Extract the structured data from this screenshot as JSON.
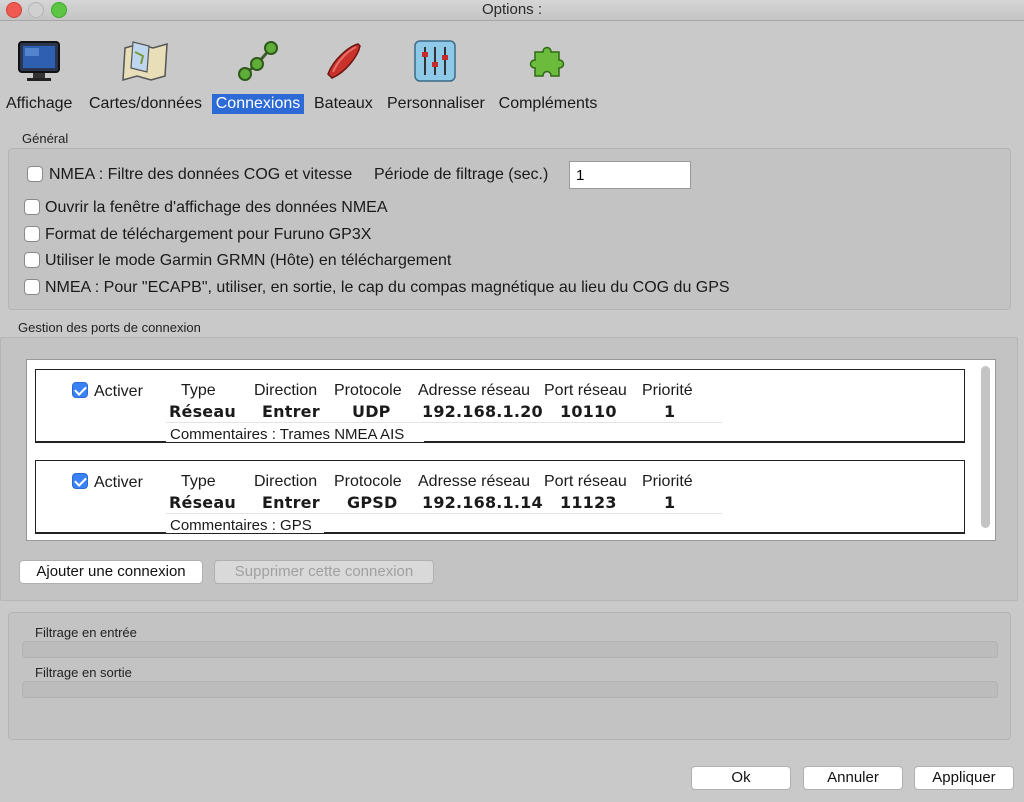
{
  "window": {
    "title": "Options :"
  },
  "toolbar": {
    "items": [
      {
        "label": "Affichage",
        "icon": "monitor-icon",
        "selected": false
      },
      {
        "label": "Cartes/données",
        "icon": "charts-icon",
        "selected": false
      },
      {
        "label": "Connexions",
        "icon": "connections-icon",
        "selected": true
      },
      {
        "label": "Bateaux",
        "icon": "boat-icon",
        "selected": false
      },
      {
        "label": "Personnaliser",
        "icon": "sliders-icon",
        "selected": false
      },
      {
        "label": "Compléments",
        "icon": "puzzle-icon",
        "selected": false
      }
    ]
  },
  "general": {
    "title": "Général",
    "filter_checkbox": {
      "label": "NMEA : Filtre des données COG et vitesse",
      "checked": false
    },
    "filter_period_label": "Période de filtrage (sec.)",
    "filter_period_value": "1",
    "options": [
      {
        "label": "Ouvrir la fenêtre d'affichage des données NMEA",
        "checked": false
      },
      {
        "label": "Format de téléchargement pour Furuno GP3X",
        "checked": false
      },
      {
        "label": "Utiliser le mode Garmin GRMN (Hôte) en téléchargement",
        "checked": false
      },
      {
        "label": "NMEA : Pour \"ECAPB\", utiliser, en sortie, le cap du compas magnétique  au lieu du COG du GPS",
        "checked": false
      }
    ]
  },
  "ports": {
    "title": "Gestion des ports de connexion",
    "headers": {
      "enable": "Activer",
      "type": "Type",
      "direction": "Direction",
      "protocol": "Protocole",
      "address": "Adresse réseau",
      "port": "Port réseau",
      "priority": "Priorité"
    },
    "connections": [
      {
        "enabled": true,
        "type": "Réseau",
        "direction": "Entrer",
        "protocol": "UDP",
        "address": "192.168.1.20",
        "port": "10110",
        "priority": "1",
        "comment": "Commentaires : Trames NMEA AIS"
      },
      {
        "enabled": true,
        "type": "Réseau",
        "direction": "Entrer",
        "protocol": "GPSD",
        "address": "192.168.1.14",
        "port": "11123",
        "priority": "1",
        "comment": "Commentaires : GPS"
      }
    ],
    "add_button": "Ajouter une connexion",
    "remove_button": "Supprimer cette connexion"
  },
  "filtering": {
    "input_label": "Filtrage en entrée",
    "output_label": "Filtrage en sortie"
  },
  "footer": {
    "ok": "Ok",
    "cancel": "Annuler",
    "apply": "Appliquer"
  }
}
